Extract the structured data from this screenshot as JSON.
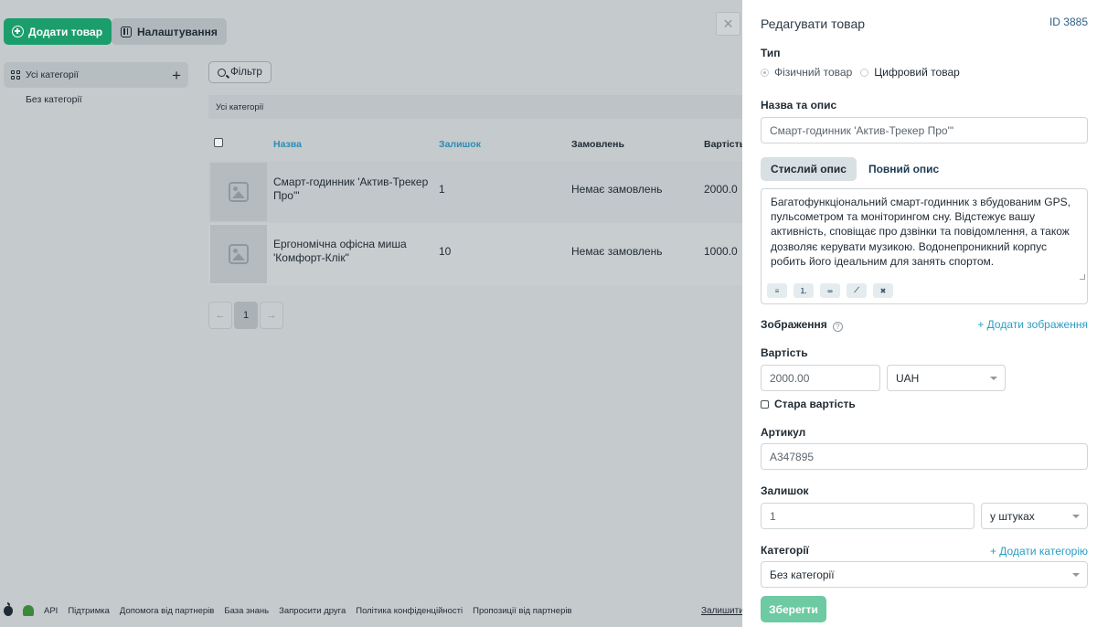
{
  "toolbar": {
    "add_product_label": "Додати товар",
    "settings_label": "Налаштування"
  },
  "categories": {
    "all_label": "Усі категорії",
    "none_label": "Без категорії"
  },
  "filter_label": "Фільтр",
  "breadcrumb": "Усі категорії",
  "table": {
    "headers": {
      "name": "Назва",
      "stock": "Залишок",
      "orders": "Замовлень",
      "price": "Вартість"
    },
    "rows": [
      {
        "name": "Смарт-годинник 'Актив-Трекер Про'\"",
        "stock": "1",
        "orders": "Немає замовлень",
        "price": "2000.0"
      },
      {
        "name": "Ергономічна офісна миша 'Комфорт-Клік\"",
        "stock": "10",
        "orders": "Немає замовлень",
        "price": "1000.0"
      }
    ]
  },
  "pager": {
    "prev": "←",
    "page": "1",
    "next": "→"
  },
  "footer": {
    "links": [
      "API",
      "Підтримка",
      "Допомога від партнерів",
      "База знань",
      "Запросити друга",
      "Політика конфіденційності",
      "Пропозиції від партнерів"
    ],
    "leave_label": "Залишити"
  },
  "close_symbol": "×",
  "drawer": {
    "title": "Редагувати товар",
    "id_label": "ID 3885",
    "type_label": "Тип",
    "type_physical": "Фізичний товар",
    "type_digital": "Цифровий товар",
    "name_section_label": "Назва та опис",
    "name_value": "Смарт-годинник 'Актив-Трекер Про'\"",
    "tab_short": "Стислий опис",
    "tab_full": "Повний опис",
    "description": "Багатофункціональний смарт-годинник з вбудованим GPS, пульсометром та моніторингом сну. Відстежує вашу активність, сповіщає про дзвінки та повідомлення, а також дозволяє керувати музикою. Водонепроникний корпус робить його ідеальним для занять спортом.",
    "images_label": "Зображення",
    "add_image_label": "+ Додати зображення",
    "price_label": "Вартість",
    "price_value": "2000.00",
    "currency_value": "UAH",
    "old_price_label": "Стара вартість",
    "sku_label": "Артикул",
    "sku_value": "A347895",
    "stock_label": "Залишок",
    "stock_value": "1",
    "stock_unit": "у штуках",
    "category_label": "Категорії",
    "add_category_label": "+ Додати категорію",
    "category_value": "Без категорії",
    "save_label": "Зберегти",
    "help_symbol": "?",
    "editor_tools": [
      "≡",
      "⒈",
      "∞",
      "⟋",
      "✖"
    ]
  }
}
